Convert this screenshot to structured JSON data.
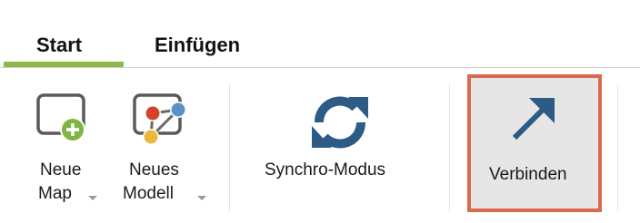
{
  "tabs": [
    {
      "label": "Start",
      "active": true
    },
    {
      "label": "Einfügen",
      "active": false
    }
  ],
  "ribbon": {
    "neue_map": {
      "line1": "Neue",
      "line2": "Map",
      "has_dropdown": true,
      "icon": "new-map-icon"
    },
    "neues_modell": {
      "line1": "Neues",
      "line2": "Modell",
      "has_dropdown": true,
      "icon": "new-model-icon"
    },
    "synchro_modus": {
      "label": "Synchro-Modus",
      "icon": "sync-icon"
    },
    "verbinden": {
      "label": "Verbinden",
      "icon": "arrow-up-right-icon",
      "highlighted": true
    }
  },
  "colors": {
    "accent_green": "#8fb84a",
    "icon_blue": "#2d5b85",
    "highlight_border": "#d76a4f",
    "highlight_bg": "#e6e6e6"
  }
}
